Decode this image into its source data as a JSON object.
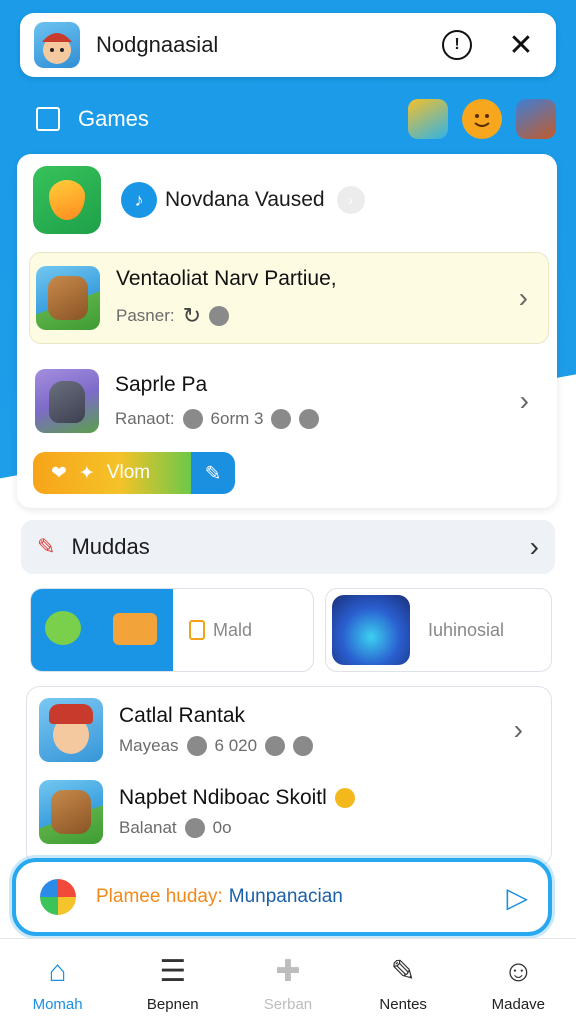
{
  "header": {
    "title": "Nodgnaasial",
    "info_icon": "!",
    "close_icon": "✕"
  },
  "games_row": {
    "label": "Games"
  },
  "featured": {
    "title": "Novdana Vaused"
  },
  "games": [
    {
      "name": "Ventaoliat Narv Partiue,",
      "meta": "Pasner:",
      "icon": "wooden-character-icon"
    },
    {
      "name": "Saprle Pa",
      "meta": "Ranaot:",
      "meta_extra": "6orm 3",
      "icon": "creature-character-icon"
    }
  ],
  "pill": {
    "label": "Vlom"
  },
  "section": {
    "label": "Muddas"
  },
  "tiles": {
    "left_label": "Mald",
    "right_label": "Iuhinosial"
  },
  "list2": [
    {
      "name": "Catlal Rantak",
      "meta": "Mayeas",
      "meta_extra": "6 020"
    },
    {
      "name": "Napbet Ndiboac Skoitl",
      "meta": "Balanat",
      "meta_extra": "0o"
    }
  ],
  "promo": {
    "text_a": "Plamee huday:",
    "text_b": "Munpanacian"
  },
  "nav": [
    {
      "label": "Momah"
    },
    {
      "label": "Bepnen"
    },
    {
      "label": "Serban"
    },
    {
      "label": "Nentes"
    },
    {
      "label": "Madave"
    }
  ],
  "colors": {
    "brand_blue": "#1b9be8",
    "promo_orange": "#f08a1a"
  }
}
